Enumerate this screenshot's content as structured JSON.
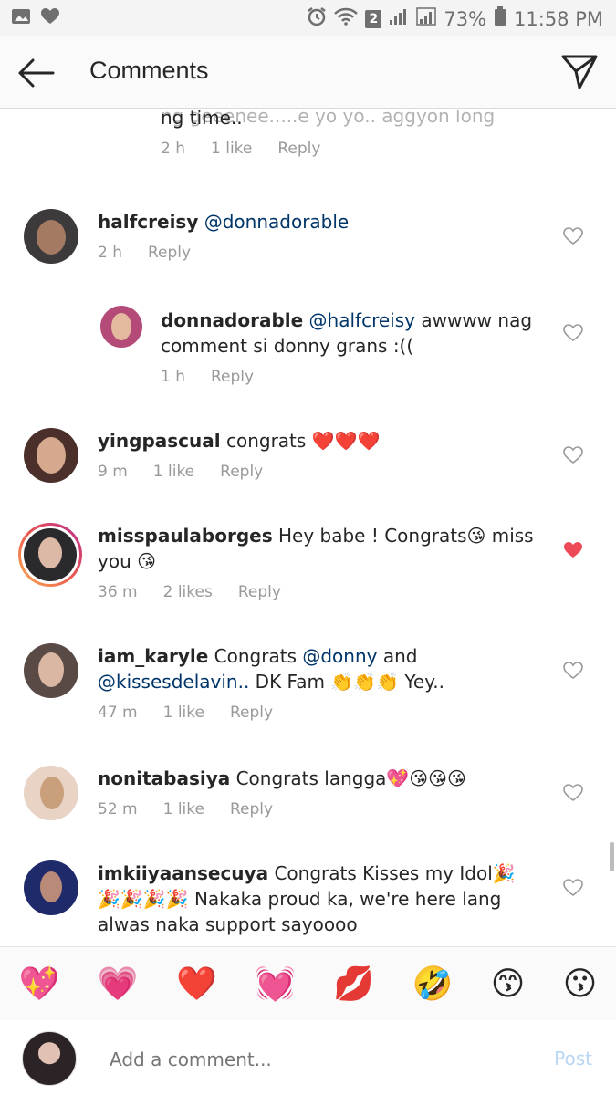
{
  "status_bar": {
    "battery": "73%",
    "time": "11:58 PM",
    "sim": "2"
  },
  "header": {
    "title": "Comments"
  },
  "comments": [
    {
      "partial_text": "ng time..",
      "age": "2 h",
      "likes": "1 like",
      "reply": "Reply"
    },
    {
      "username": "halfcreisy",
      "mention": "@donnadorable",
      "text": "",
      "age": "2 h",
      "likes": "",
      "reply": "Reply"
    },
    {
      "username": "donnadorable",
      "mention": "@halfcreisy",
      "text_line1": "awwww nag",
      "text_line2": "comment si donny grans :((",
      "age": "1 h",
      "reply": "Reply"
    },
    {
      "username": "yingpascual",
      "text": "congrats ❤️❤️❤️",
      "age": "9 m",
      "likes": "1 like",
      "reply": "Reply"
    },
    {
      "username": "misspaulaborges",
      "text_line1": "Hey babe ! Congrats😘 miss",
      "text_line2": "you 😘",
      "age": "36 m",
      "likes": "2 likes",
      "reply": "Reply"
    },
    {
      "username": "iam_karyle",
      "text_a": "Congrats",
      "mention1": "@donny",
      "text_b": "and",
      "mention2": "@kissesdelavin..",
      "text_c": "DK Fam 👏👏👏 Yey..",
      "age": "47 m",
      "likes": "1 like",
      "reply": "Reply"
    },
    {
      "username": "nonitabasiya",
      "text": "Congrats langga💖😘😘😘",
      "age": "52 m",
      "likes": "1 like",
      "reply": "Reply"
    },
    {
      "username": "imkiiyaansecuya",
      "text_line1": "Congrats Kisses my Idol🎉",
      "text_line2": "🎉🎉🎉🎉 Nakaka proud ka, we're here lang",
      "text_line3": "alwas naka support sayoooo"
    }
  ],
  "emoji_bar": [
    "💖",
    "💗",
    "❤️",
    "💓",
    "💋",
    "🤣",
    "😙",
    "😗"
  ],
  "compose": {
    "placeholder": "Add a comment...",
    "post_label": "Post"
  },
  "colors": {
    "mention": "#003569",
    "liked_heart": "#ed4956",
    "meta": "#999999",
    "post_disabled": "#b9d7f3"
  }
}
